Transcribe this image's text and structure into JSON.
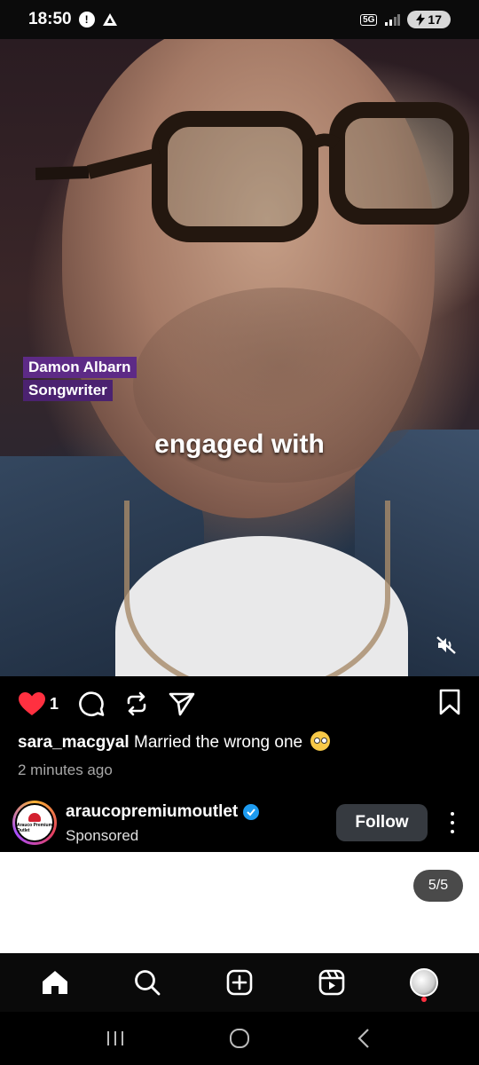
{
  "status_bar": {
    "time": "18:50",
    "network": "5G",
    "battery": "17"
  },
  "video": {
    "name_tag_name": "Damon Albarn",
    "name_tag_role": "Songwriter",
    "caption": "engaged with",
    "muted": true
  },
  "post": {
    "liked": true,
    "like_count": "1",
    "comment_user": "sara_macgyal",
    "comment_text": "Married the wrong one",
    "comment_emoji": "rolling-eyes-emoji",
    "timestamp": "2 minutes ago"
  },
  "sponsor": {
    "account": "araucopremiumoutlet",
    "verified": true,
    "label": "Sponsored",
    "avatar_text": "Arauco Premium Outlet",
    "follow_label": "Follow"
  },
  "ad": {
    "pager": "5/5"
  },
  "bottom_nav": [
    "home-icon",
    "search-icon",
    "create-icon",
    "reels-icon",
    "profile-avatar"
  ],
  "colors": {
    "like_red": "#ff3040",
    "verified_blue": "#1d9bf0",
    "follow_bg": "#363a40",
    "name_tag_purple": "#5d2a86"
  }
}
